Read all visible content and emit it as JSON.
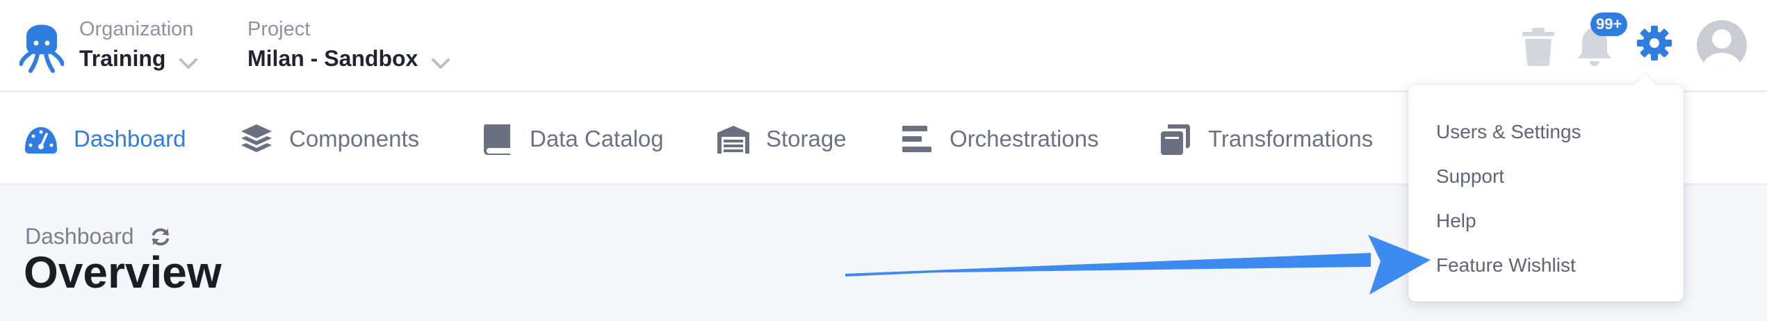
{
  "header": {
    "organization": {
      "caption": "Organization",
      "value": "Training"
    },
    "project": {
      "caption": "Project",
      "value": "Milan - Sandbox"
    },
    "notifications_badge": "99+"
  },
  "nav": {
    "items": [
      {
        "label": "Dashboard",
        "icon": "gauge-icon",
        "active": true
      },
      {
        "label": "Components",
        "icon": "layers-icon"
      },
      {
        "label": "Data Catalog",
        "icon": "book-icon"
      },
      {
        "label": "Storage",
        "icon": "warehouse-icon"
      },
      {
        "label": "Orchestrations",
        "icon": "bars-icon"
      },
      {
        "label": "Transformations",
        "icon": "copy-icon"
      }
    ]
  },
  "page": {
    "breadcrumb": "Dashboard",
    "title": "Overview"
  },
  "settings_menu": {
    "items": [
      "Users & Settings",
      "Support",
      "Help",
      "Feature Wishlist"
    ]
  },
  "colors": {
    "accent": "#2f7de1",
    "nav_text": "#6c7281",
    "icon_gray": "#6b7080",
    "page_bg": "#f5f6f9",
    "annotation_arrow": "#3d8af0"
  }
}
